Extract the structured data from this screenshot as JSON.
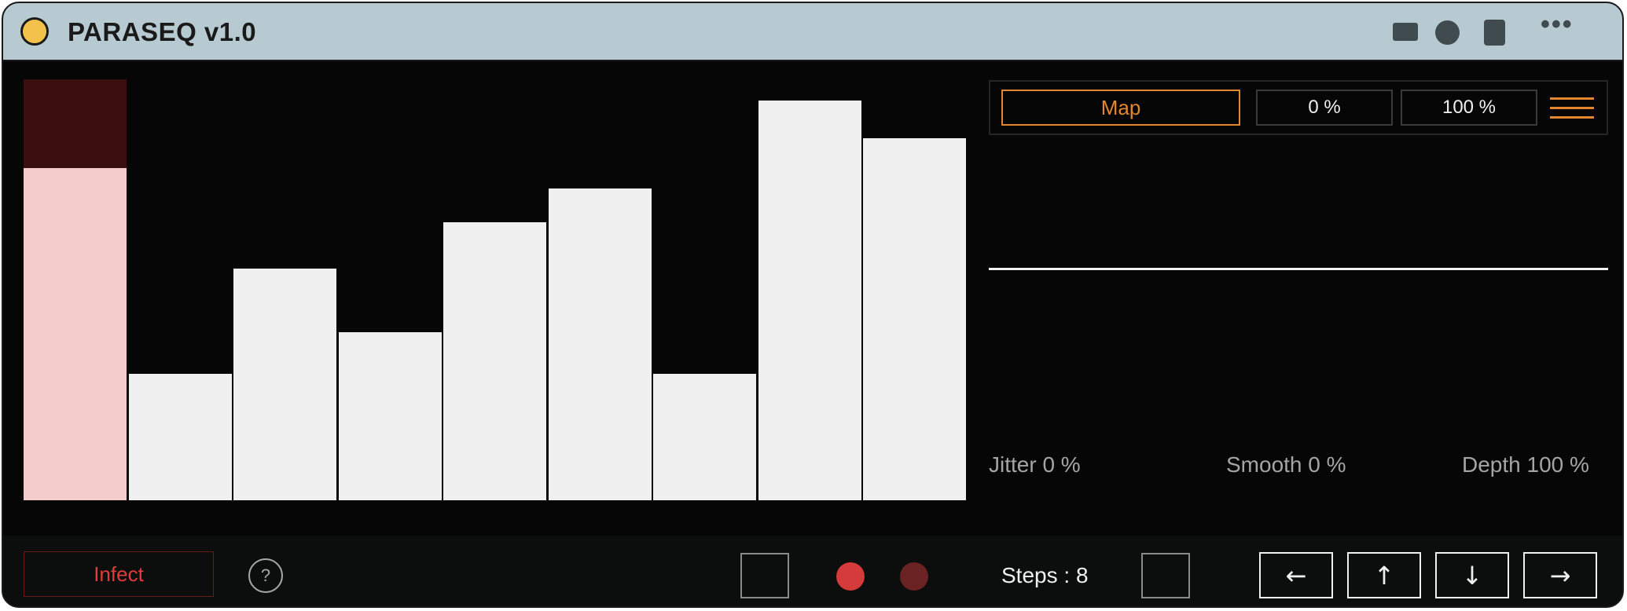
{
  "window": {
    "title": "PARASEQ v1.0",
    "icons": [
      "status-dot",
      "panel-icon",
      "circle-icon",
      "square-icon",
      "more-icon"
    ],
    "more_glyph": "•••"
  },
  "sequencer": {
    "steps_count": 8,
    "step_values": [
      0.79,
      0.3,
      0.55,
      0.4,
      0.66,
      0.74,
      0.3,
      0.95,
      0.86
    ],
    "active_step": 1,
    "colors": {
      "bar": "#f0f0f0",
      "active_bar": "#f4cccc",
      "active_shade": "#3b0f10"
    }
  },
  "mapping": {
    "map_label": "Map",
    "min_value": "0 %",
    "max_value": "100 %",
    "jitter_label": "Jitter 0 %",
    "smooth_label": "Smooth 0 %",
    "depth_label": "Depth 100 %",
    "accent_color": "#e2872f"
  },
  "footer": {
    "infect_label": "Infect",
    "help_label": "?",
    "steps_label": "Steps : 8",
    "arrows": {
      "left": "←",
      "up": "↑",
      "down": "↓",
      "right": "→"
    },
    "record_color": "#d63b3b",
    "record_dim_color": "#6b2222"
  }
}
